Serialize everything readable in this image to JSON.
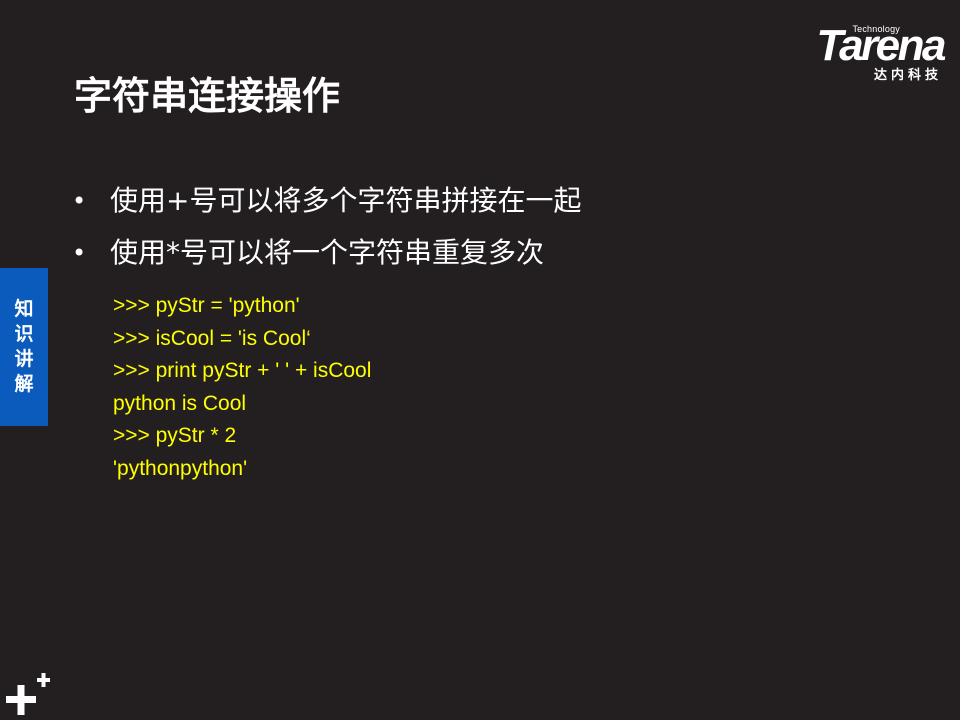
{
  "logo": {
    "tagline": "Technology",
    "wordmark": "Tarena",
    "chinese": "达内科技"
  },
  "title": "字符串连接操作",
  "bullets": [
    "使用+号可以将多个字符串拼接在一起",
    "使用*号可以将一个字符串重复多次"
  ],
  "code_lines": [
    ">>> pyStr = 'python'",
    ">>> isCool = 'is Cool‘",
    ">>> print pyStr + ' ' + isCool",
    "python is Cool",
    ">>> pyStr * 2",
    "'pythonpython'"
  ],
  "side_tab": [
    "知",
    "识",
    "讲",
    "解"
  ],
  "bullet_symbol": "•",
  "colors": {
    "background": "#231f20",
    "code": "#ffff00",
    "side_tab": "#0b5bbd",
    "text": "#ffffff"
  },
  "icons": {
    "bottom_left": "plus-icon"
  }
}
